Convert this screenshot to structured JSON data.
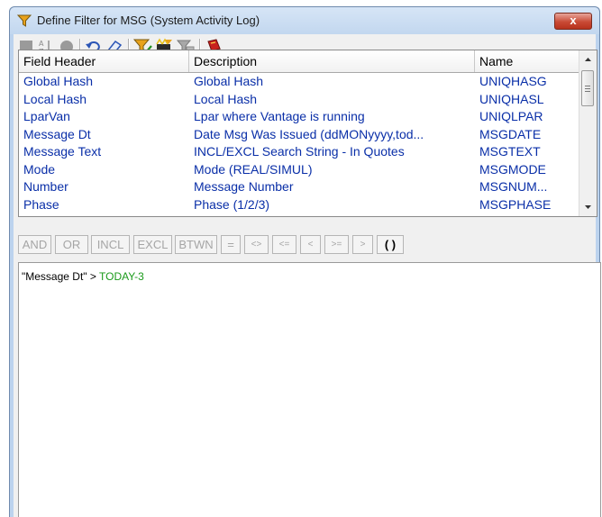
{
  "window": {
    "title": "Define Filter for MSG (System Activity Log)"
  },
  "title_icon": "funnel-icon",
  "close_label": "x",
  "toolbar": [
    {
      "icon": "stop-square-icon"
    },
    {
      "icon": "sort-az-icon"
    },
    {
      "icon": "record-circle-icon"
    },
    {
      "icon": "undo-icon"
    },
    {
      "icon": "eraser-icon"
    },
    {
      "icon": "filter-check-icon"
    },
    {
      "icon": "filter-clapper-icon"
    },
    {
      "icon": "filter-gray-icon"
    },
    {
      "icon": "book-icon"
    }
  ],
  "grid": {
    "columns": [
      "Field Header",
      "Description",
      "Name"
    ],
    "rows": [
      [
        "Global Hash",
        "Global Hash",
        "UNIQHASG"
      ],
      [
        "Local Hash",
        "Local Hash",
        "UNIQHASL"
      ],
      [
        "LparVan",
        "Lpar where Vantage is running",
        "UNIQLPAR"
      ],
      [
        "Message Dt",
        "Date Msg Was Issued (ddMONyyyy,tod...",
        "MSGDATE"
      ],
      [
        "Message Text",
        "INCL/EXCL Search String - In Quotes",
        "MSGTEXT"
      ],
      [
        "Mode",
        "Mode (REAL/SIMUL)",
        "MSGMODE"
      ],
      [
        "Number",
        "Message Number",
        "MSGNUM..."
      ],
      [
        "Phase",
        "Phase (1/2/3)",
        "MSGPHASE"
      ]
    ]
  },
  "operators": [
    "AND",
    "OR",
    "INCL",
    "EXCL",
    "BTWN",
    "=",
    "<>",
    "<=",
    "<",
    ">=",
    ">",
    "( )"
  ],
  "expression": {
    "field": "\"Message Dt\"",
    "op": " > ",
    "value": "TODAY-3"
  }
}
